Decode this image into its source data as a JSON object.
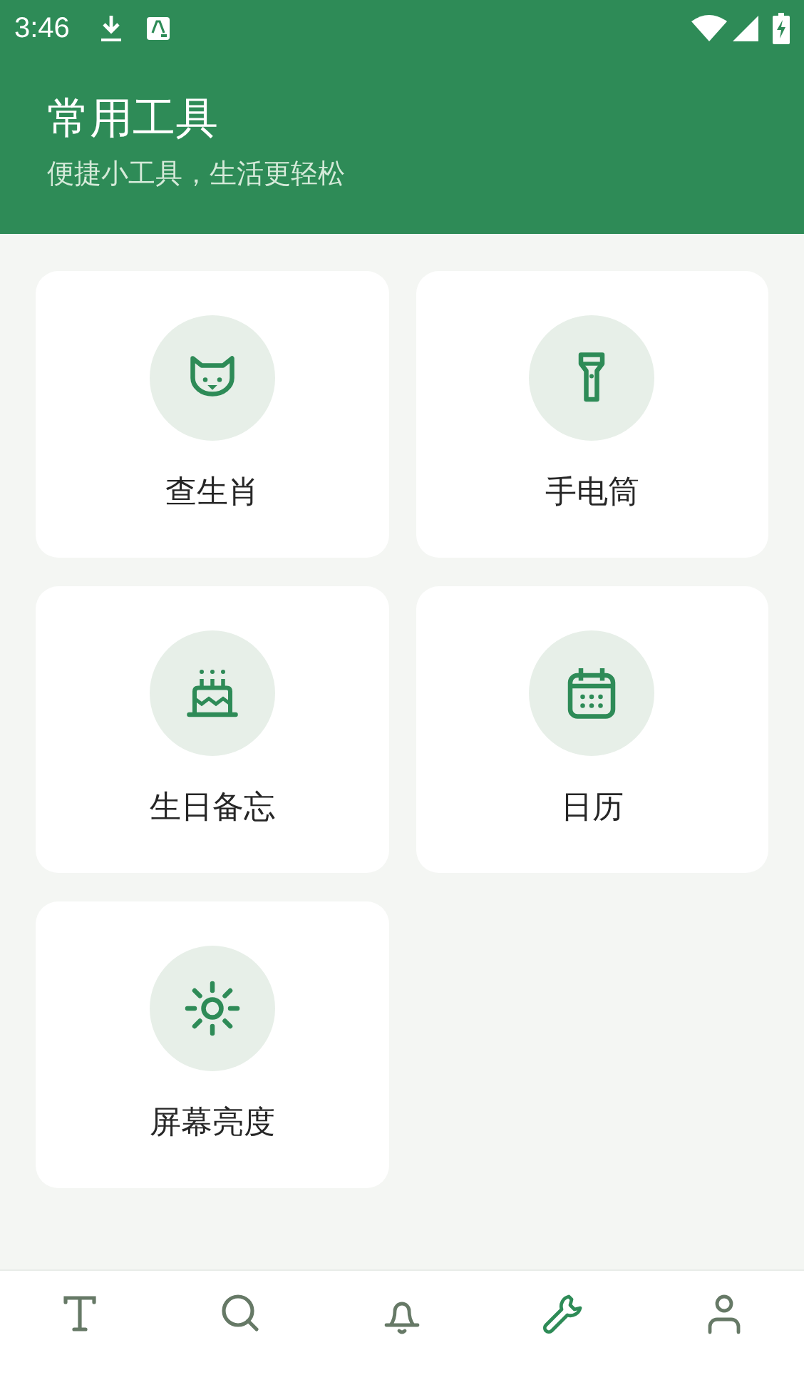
{
  "status_bar": {
    "time": "3:46"
  },
  "header": {
    "title": "常用工具",
    "subtitle": "便捷小工具，生活更轻松"
  },
  "tools": [
    {
      "label": "查生肖",
      "kind": "cat"
    },
    {
      "label": "手电筒",
      "kind": "flashlight"
    },
    {
      "label": "生日备忘",
      "kind": "cake"
    },
    {
      "label": "日历",
      "kind": "calendar"
    },
    {
      "label": "屏幕亮度",
      "kind": "sun"
    }
  ],
  "nav": [
    {
      "kind": "text",
      "selected": false
    },
    {
      "kind": "search",
      "selected": false
    },
    {
      "kind": "bell",
      "selected": false
    },
    {
      "kind": "wrench",
      "selected": true
    },
    {
      "kind": "person",
      "selected": false
    }
  ]
}
